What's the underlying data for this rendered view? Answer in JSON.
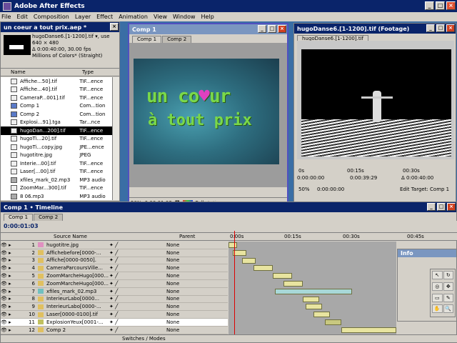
{
  "app": {
    "title": "Adobe After Effects"
  },
  "menu": [
    "File",
    "Edit",
    "Composition",
    "Layer",
    "Effect",
    "Animation",
    "View",
    "Window",
    "Help"
  ],
  "project": {
    "title": "un coeur a tout prix.aep *",
    "info": [
      "hugoDanse6.[1-1200].tif ▾, use",
      "640 × 480",
      "Δ 0:00:40:00, 30.00 fps",
      "Millions of Colors* (Straight)"
    ],
    "columns": {
      "name": "Name",
      "type": "Type"
    },
    "items": [
      {
        "name": "Affiche...50].tif",
        "type": "TIF...ence",
        "kind": "still"
      },
      {
        "name": "Affiche...40].tif",
        "type": "TIF...ence",
        "kind": "still"
      },
      {
        "name": "CameraP...001].tif",
        "type": "TIF...ence",
        "kind": "still"
      },
      {
        "name": "Comp 1",
        "type": "Com...tion",
        "kind": "comp"
      },
      {
        "name": "Comp 2",
        "type": "Com...tion",
        "kind": "comp"
      },
      {
        "name": "Explosi...91].tga",
        "type": "Tar...nce",
        "kind": "still"
      },
      {
        "name": "hugoDan...200].tif",
        "type": "TIF...ence",
        "kind": "still",
        "selected": true
      },
      {
        "name": "hugoTi...20].tif",
        "type": "TIF...ence",
        "kind": "still"
      },
      {
        "name": "hugoTi...copy.jpg",
        "type": "JPE...ence",
        "kind": "still"
      },
      {
        "name": "hugotitre.jpg",
        "type": "JPEG",
        "kind": "still"
      },
      {
        "name": "Interie...00].tif",
        "type": "TIF...ence",
        "kind": "still"
      },
      {
        "name": "Laser[...00].tif",
        "type": "TIF...ence",
        "kind": "still"
      },
      {
        "name": "xfiles_mark_02.mp3",
        "type": "MP3 audio",
        "kind": "audio"
      },
      {
        "name": "ZoomMar...300].tif",
        "type": "TIF...ence",
        "kind": "still"
      },
      {
        "name": "8 06.mp3",
        "type": "MP3 audio",
        "kind": "audio"
      }
    ]
  },
  "comp": {
    "title": "Comp 1",
    "tabs": [
      "Comp 1",
      "Comp 2"
    ],
    "line1": "un co",
    "heart": "♥",
    "line1b": "ur",
    "line2": "à tout prix",
    "zoom": "50%",
    "time": "0:00:01:03",
    "res": "Full",
    "active": "Active"
  },
  "footage": {
    "title": "hugoDanse6.[1-1200].tif (Footage)",
    "tab": "hugoDanse6.[1-1200].tif",
    "ruler": [
      "0s",
      "00:15s",
      "00:30s"
    ],
    "in": "0:00:00:00",
    "out": "0:00:39:29",
    "dur": "Δ 0:00:40:00",
    "zoom": "50%",
    "time": "0:00:00:00",
    "edit_target": "Edit Target: Comp 1"
  },
  "timeline": {
    "title": "Comp 1 • Timeline",
    "tabs": [
      "Comp 1",
      "Comp 2"
    ],
    "time": "0:00:01:03",
    "columns": {
      "source": "Source Name",
      "parent": "Parent"
    },
    "ruler": [
      "0:00s",
      "00:15s",
      "00:30s",
      "00:45s"
    ],
    "footer": "Switches / Modes",
    "layers": [
      {
        "num": "1",
        "name": "hugotitre.jpg",
        "parent": "None",
        "color": "#e090c0",
        "start": 0,
        "len": 6
      },
      {
        "num": "2",
        "name": "Affichebefore[0000-...",
        "parent": "None",
        "color": "#e0c060",
        "start": 3,
        "len": 10
      },
      {
        "num": "3",
        "name": "Affiche[0000-0050].",
        "parent": "None",
        "color": "#e0c060",
        "start": 10,
        "len": 10
      },
      {
        "num": "4",
        "name": "CameraParcoursVille...",
        "parent": "None",
        "color": "#e0c060",
        "start": 18,
        "len": 14
      },
      {
        "num": "5",
        "name": "ZoomMarcheHugo[000...",
        "parent": "None",
        "color": "#e0c060",
        "start": 32,
        "len": 14
      },
      {
        "num": "6",
        "name": "ZoomMarcheHugo[000...",
        "parent": "None",
        "color": "#e0c060",
        "start": 40,
        "len": 14
      },
      {
        "num": "7",
        "name": "xfiles_mark_02.mp3",
        "parent": "None",
        "color": "#70c0c0",
        "start": 34,
        "len": 56
      },
      {
        "num": "8",
        "name": "InterieurLabo[0000...",
        "parent": "None",
        "color": "#e0c060",
        "start": 54,
        "len": 12
      },
      {
        "num": "9",
        "name": "InterieurLabo[0000-...",
        "parent": "None",
        "color": "#e0c060",
        "start": 56,
        "len": 12
      },
      {
        "num": "10",
        "name": "Laser[0000-0100].tif",
        "parent": "None",
        "color": "#e0c060",
        "start": 62,
        "len": 12
      },
      {
        "num": "11",
        "name": "ExplosionYeux[0001-...",
        "parent": "None",
        "color": "#c0c060",
        "start": 70,
        "len": 12,
        "selected": true
      },
      {
        "num": "12",
        "name": "Comp 2",
        "parent": "None",
        "color": "#e0c060",
        "start": 82,
        "len": 40
      }
    ]
  },
  "info": {
    "label": "Info"
  }
}
